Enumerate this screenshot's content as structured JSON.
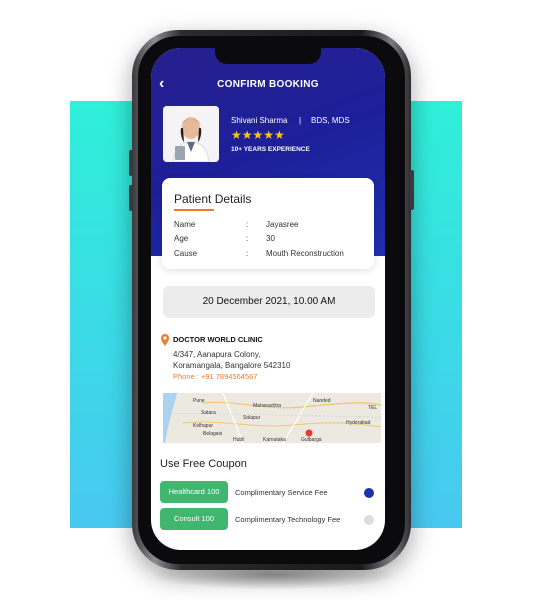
{
  "header": {
    "back_icon": "chevron-left-icon",
    "back_glyph": "‹",
    "title": "CONFIRM BOOKING"
  },
  "doctor": {
    "name": "Shivani Sharma",
    "separator": "|",
    "degree": "BDS, MDS",
    "stars": "★★★★★",
    "rating": 5,
    "experience": "10+ YEARS EXPERIENCE"
  },
  "patient": {
    "section_title": "Patient Details",
    "rows": [
      {
        "label": "Name",
        "colon": ":",
        "value": "Jayasree"
      },
      {
        "label": "Age",
        "colon": ":",
        "value": "30"
      },
      {
        "label": "Cause",
        "colon": ":",
        "value": "Mouth Reconstruction"
      }
    ]
  },
  "appointment": {
    "datetime": "20 December 2021, 10.00 AM"
  },
  "clinic": {
    "name": "DOCTOR WORLD CLINIC",
    "address_line1": "4/347, Aanapura Colony,",
    "address_line2": "Koramangala, Bangalore 542310",
    "phone": "Phone : +91 7894564567"
  },
  "map": {
    "labels": [
      "Pune",
      "Maharashtra",
      "Satara",
      "Solapur",
      "Kolhapur",
      "Belagavi",
      "Hubli",
      "Karnataka",
      "Nanded",
      "Hyderabad",
      "Gulbarga",
      "TEL"
    ]
  },
  "coupon": {
    "section_title": "Use Free Coupon",
    "items": [
      {
        "code": "Healthcard 100",
        "description": "Complimentary Service Fee",
        "selected": true
      },
      {
        "code": "Consult 100",
        "description": "Complimentary Technology Fee",
        "selected": false
      }
    ]
  },
  "colors": {
    "header": "#1d1f9a",
    "accent": "#f07a2a",
    "coupon_green": "#41b66e",
    "radio_selected": "#1f2fae",
    "background_teal": "#2ff0d8"
  }
}
